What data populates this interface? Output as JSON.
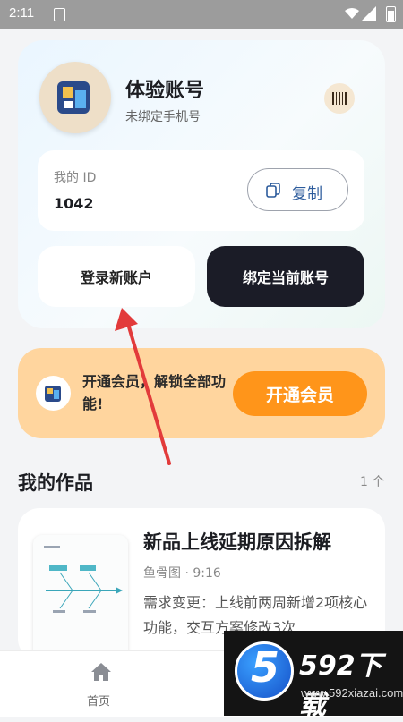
{
  "status_bar": {
    "time": "2:11"
  },
  "profile": {
    "account_name": "体验账号",
    "phone_status": "未绑定手机号",
    "id_label": "我的 ID",
    "id_value": "1042",
    "copy_label": "复制",
    "login_new_label": "登录新账户",
    "bind_current_label": "绑定当前账号"
  },
  "membership": {
    "promo_text": "开通会员，解锁全部功能!",
    "button_label": "开通会员"
  },
  "works": {
    "section_title": "我的作品",
    "count": "1 个",
    "items": [
      {
        "title": "新品上线延期原因拆解",
        "meta": "鱼骨图 · 9:16",
        "description": "需求变更：上线前两周新增2项核心功能，交互方案修改3次…"
      }
    ]
  },
  "bottom_nav": {
    "home_label": "首页"
  },
  "watermark": {
    "brand": "592下载",
    "url": "www.592xiazai.com"
  },
  "colors": {
    "accent_orange": "#ff951a",
    "dark_button": "#1b1c27",
    "membership_bg": "#ffd59e",
    "annotation_red": "#e23b3b"
  },
  "icons": [
    "app-logo-icon",
    "barcode-icon",
    "copy-icon",
    "home-icon",
    "wifi-icon",
    "signal-icon",
    "battery-icon"
  ]
}
